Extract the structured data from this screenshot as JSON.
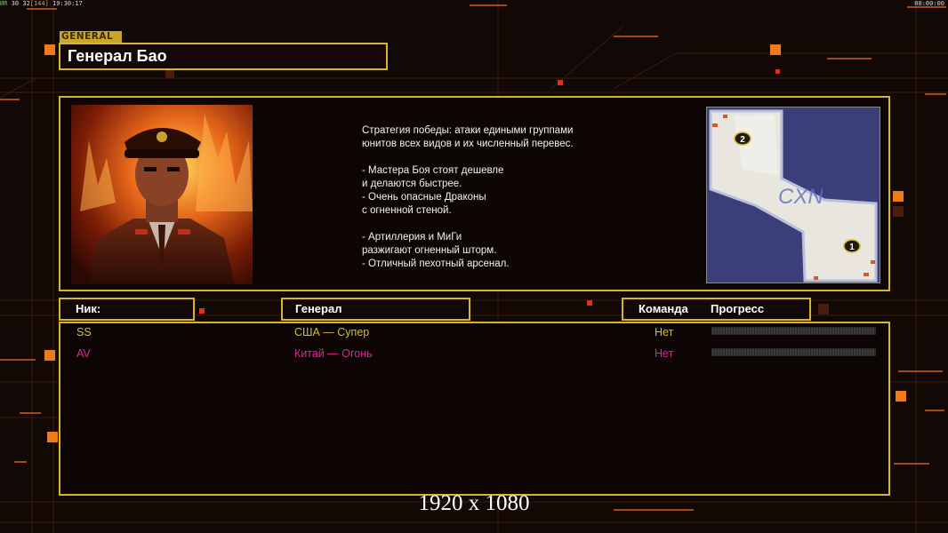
{
  "status_bar": {
    "fps_label": "ИR",
    "fps_a": "30",
    "fps_b": "32",
    "fps_bracket": "[144]",
    "clock": "19:30:17",
    "timer": "00:00:00"
  },
  "general": {
    "tag": "GENERAL",
    "name": "Генерал Бао",
    "description": [
      "Стратегия победы: атаки едиными группами",
      "юнитов всех видов и их численный перевес.",
      "",
      "- Мастера Боя стоят дешевле",
      "и делаются быстрее.",
      "- Очень опасные Драконы",
      "с огненной стеной.",
      "",
      "- Артиллерия и МиГи",
      "разжигают огненный шторм.",
      "- Отличный пехотный арсенал."
    ]
  },
  "minimap": {
    "watermark": "CXN",
    "start_positions": [
      "2",
      "1"
    ]
  },
  "table": {
    "headers": {
      "nick": "Ник:",
      "general": "Генерал",
      "team": "Команда",
      "progress": "Прогресс"
    },
    "rows": [
      {
        "nick": "SS",
        "general": "США — Супер",
        "team": "Нет",
        "progress": 0,
        "color": "#d4c02c"
      },
      {
        "nick": "AV",
        "general": "Китай — Огонь",
        "team": "Нет",
        "progress": 0,
        "color": "#e0269c"
      }
    ]
  },
  "resolution_label": "1920 x 1080",
  "colors": {
    "accent": "#d7b52a",
    "accent_orange": "#f07a16",
    "background": "#120805"
  }
}
